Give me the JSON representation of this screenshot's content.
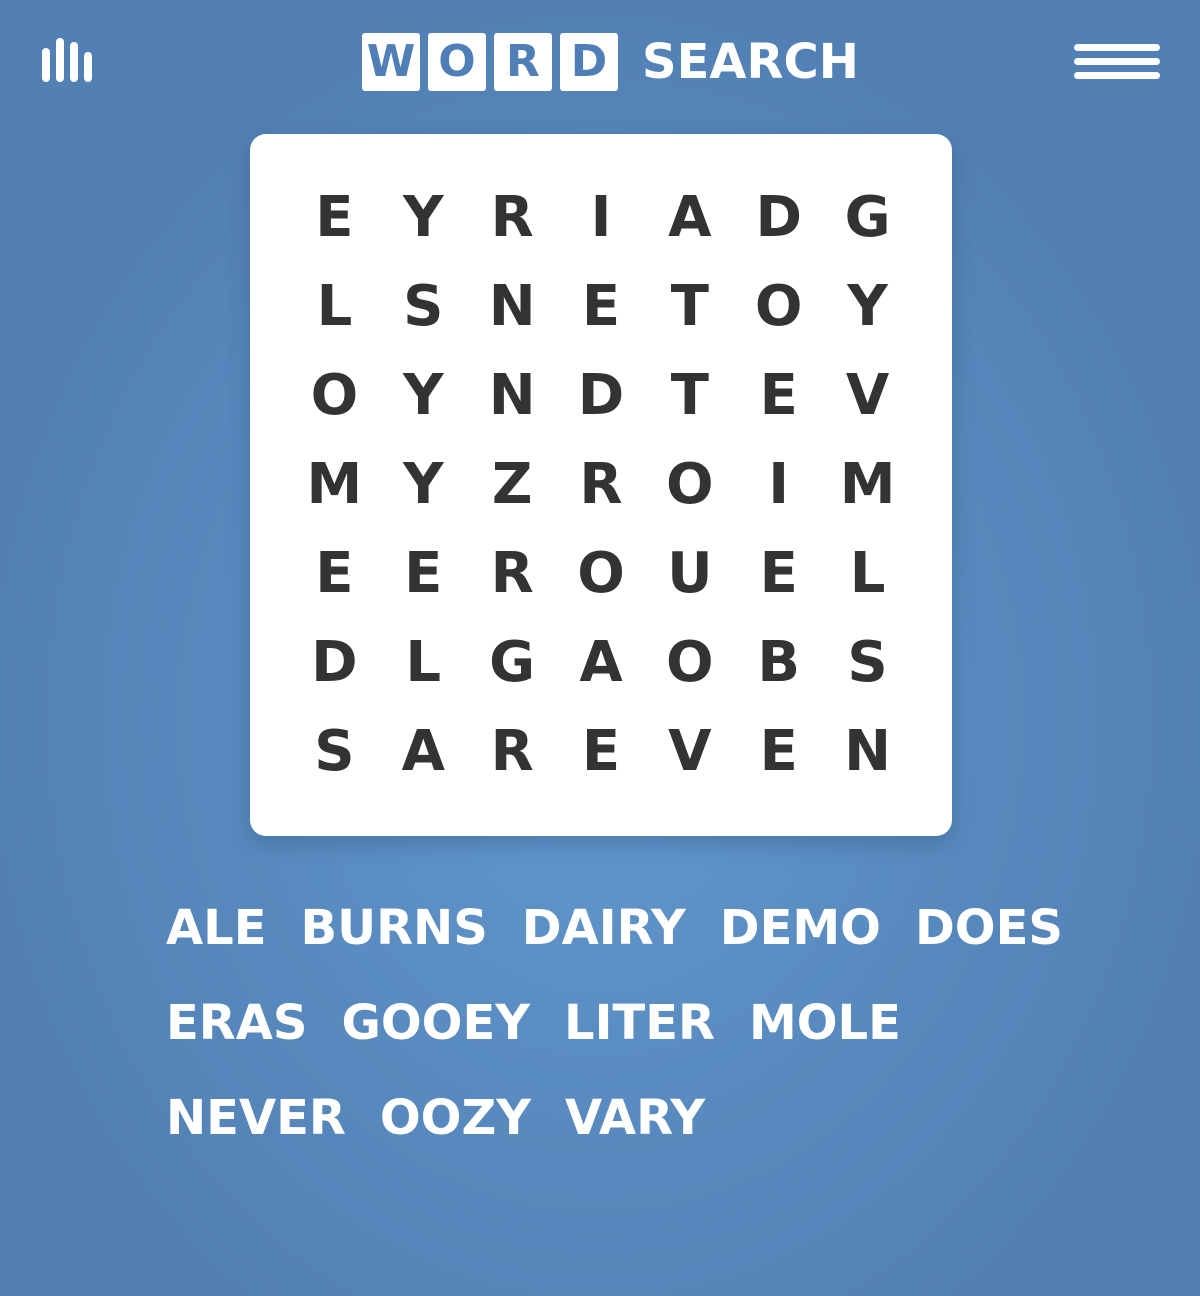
{
  "header": {
    "logo_tiles": [
      "W",
      "O",
      "R",
      "D"
    ],
    "logo_word": "SEARCH",
    "left_icon": "stats-bars-icon",
    "right_icon": "hamburger-menu-icon",
    "text_color": "#ffffff",
    "tile_text_color": "#4f7fb6"
  },
  "board": {
    "rows": [
      [
        "E",
        "Y",
        "R",
        "I",
        "A",
        "D",
        "G"
      ],
      [
        "L",
        "S",
        "N",
        "E",
        "T",
        "O",
        "Y"
      ],
      [
        "O",
        "Y",
        "N",
        "D",
        "T",
        "E",
        "V"
      ],
      [
        "M",
        "Y",
        "Z",
        "R",
        "O",
        "I",
        "M"
      ],
      [
        "E",
        "E",
        "R",
        "O",
        "U",
        "E",
        "L"
      ],
      [
        "D",
        "L",
        "G",
        "A",
        "O",
        "B",
        "S"
      ],
      [
        "S",
        "A",
        "R",
        "E",
        "V",
        "E",
        "N"
      ]
    ],
    "letter_color": "#333333",
    "background": "#ffffff"
  },
  "words": {
    "rows": [
      [
        "ALE",
        "BURNS",
        "DAIRY",
        "DEMO",
        "DOES"
      ],
      [
        "ERAS",
        "GOOEY",
        "LITER",
        "MOLE"
      ],
      [
        "NEVER",
        "OOZY",
        "VARY"
      ]
    ]
  },
  "colors": {
    "background": "#5a8dc2"
  }
}
